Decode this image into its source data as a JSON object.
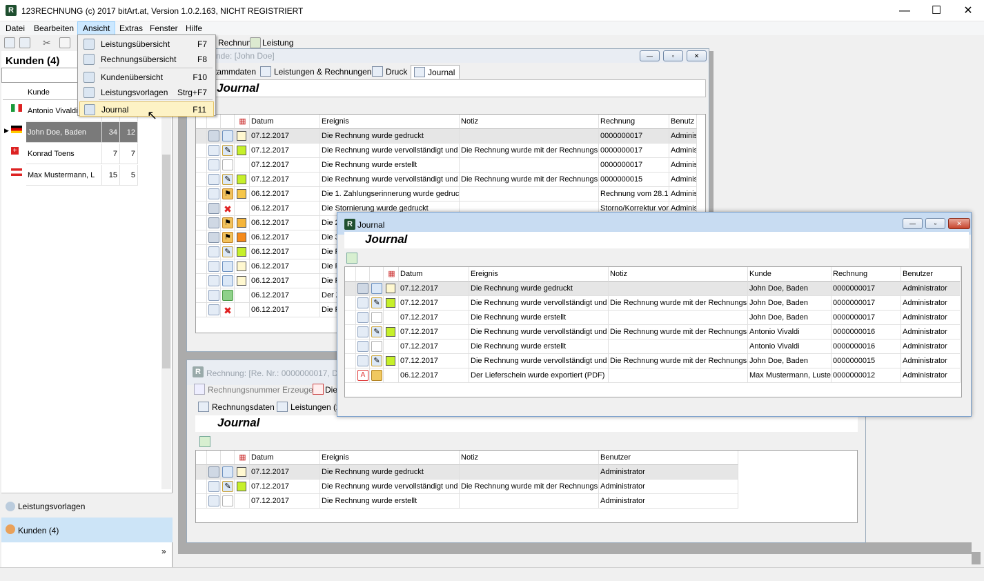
{
  "app": {
    "title": "123RECHNUNG (c) 2017 bitArt.at, Version 1.0.2.163, NICHT REGISTRIERT",
    "icon": "R"
  },
  "window_controls": {
    "minimize": "—",
    "maximize": "☐",
    "close": "✕"
  },
  "menu": [
    "Datei",
    "Bearbeiten",
    "Ansicht",
    "Extras",
    "Fenster",
    "Hilfe"
  ],
  "toolbar": {
    "rechnung_label": "Rechnung",
    "leistung_label": "Leistung"
  },
  "ansicht_menu": [
    {
      "label": "Leistungsübersicht",
      "shortcut": "F7"
    },
    {
      "label": "Rechnungsübersicht",
      "shortcut": "F8"
    },
    {
      "label": "Kundenübersicht",
      "shortcut": "F10"
    },
    {
      "label": "Leistungsvorlagen",
      "shortcut": "Strg+F7"
    },
    {
      "label": "Journal",
      "shortcut": "F11"
    }
  ],
  "left_panel": {
    "title": "Kunden (4)",
    "column_header": "Kunde",
    "customers": [
      {
        "name": "Antonio Vivaldi",
        "a": "",
        "b": "",
        "flag": "italy"
      },
      {
        "name": "John Doe, Baden",
        "a": "34",
        "b": "12",
        "flag": "germany"
      },
      {
        "name": "Konrad Toens",
        "a": "7",
        "b": "7",
        "flag": "switzerland"
      },
      {
        "name": "Max Mustermann, L",
        "a": "15",
        "b": "5",
        "flag": "austria"
      }
    ],
    "nav_leistungsvorlagen": "Leistungsvorlagen",
    "nav_kunden": "Kunden (4)",
    "more": "»"
  },
  "customer_window": {
    "title": "nde: [John Doe]",
    "tabs": [
      "tammdaten",
      "Leistungen & Rechnungen",
      "Druck",
      "Journal"
    ],
    "journal_title": "Journal",
    "headers": [
      "Datum",
      "Ereignis",
      "Notiz",
      "Rechnung",
      "Benutz"
    ],
    "rows": [
      {
        "date": "07.12.2017",
        "event": "Die Rechnung wurde gedruckt",
        "note": "",
        "invoice": "0000000017",
        "user": "Adminis",
        "status": "#fff8d0",
        "icon2": "doc"
      },
      {
        "date": "07.12.2017",
        "event": "Die Rechnung wurde vervollständigt und i",
        "note": "Die Rechnung wurde mit der Rechnungsnu",
        "invoice": "0000000017",
        "user": "Adminis",
        "status": "#c6f02a",
        "icon2": "pen"
      },
      {
        "date": "07.12.2017",
        "event": "Die Rechnung wurde erstellt",
        "note": "",
        "invoice": "0000000017",
        "user": "Adminis",
        "status": "",
        "icon2": "page"
      },
      {
        "date": "07.12.2017",
        "event": "Die Rechnung wurde vervollständigt und i",
        "note": "Die Rechnung wurde mit der Rechnungsnu",
        "invoice": "0000000015",
        "user": "Adminis",
        "status": "#c6f02a",
        "icon2": "pen"
      },
      {
        "date": "06.12.2017",
        "event": "Die 1. Zahlungserinnerung wurde gedruck",
        "note": "",
        "invoice": "Rechnung vom 28.1",
        "user": "Adminis",
        "status": "#f5c64a",
        "icon2": "flag"
      },
      {
        "date": "06.12.2017",
        "event": "Die Stornierung wurde gedruckt",
        "note": "",
        "invoice": "Storno/Korrektur vor",
        "user": "Adminis",
        "status": "",
        "icon2": "x"
      },
      {
        "date": "06.12.2017",
        "event": "Die 2",
        "note": "",
        "invoice": "",
        "user": "",
        "status": "#f5b53a",
        "icon2": "flag"
      },
      {
        "date": "06.12.2017",
        "event": "Die 3",
        "note": "",
        "invoice": "",
        "user": "",
        "status": "#f58a1a",
        "icon2": "flag"
      },
      {
        "date": "06.12.2017",
        "event": "Die R",
        "note": "",
        "invoice": "",
        "user": "",
        "status": "#c6f02a",
        "icon2": "pen"
      },
      {
        "date": "06.12.2017",
        "event": "Die R",
        "note": "",
        "invoice": "",
        "user": "",
        "status": "#fff8d0",
        "icon2": "doc"
      },
      {
        "date": "06.12.2017",
        "event": "Die R",
        "note": "",
        "invoice": "",
        "user": "",
        "status": "#fff8d0",
        "icon2": "doc"
      },
      {
        "date": "06.12.2017",
        "event": "Der Z",
        "note": "",
        "invoice": "",
        "user": "",
        "status": "",
        "icon2": "money"
      },
      {
        "date": "06.12.2017",
        "event": "Die R",
        "note": "",
        "invoice": "",
        "user": "",
        "status": "",
        "icon2": "x"
      }
    ]
  },
  "invoice_window": {
    "title": "Rechnung: [Re. Nr.: 0000000017, Dat",
    "toolbar": [
      "Rechnungsnummer Erzeugen",
      "Dies"
    ],
    "tabs": [
      "Rechnungsdaten",
      "Leistungen (2"
    ],
    "journal_title": "Journal",
    "headers": [
      "Datum",
      "Ereignis",
      "Notiz",
      "Benutzer"
    ],
    "rows": [
      {
        "date": "07.12.2017",
        "event": "Die Rechnung wurde gedruckt",
        "note": "",
        "user": "Administrator",
        "status": "#fff8d0",
        "icon2": "doc"
      },
      {
        "date": "07.12.2017",
        "event": "Die Rechnung wurde vervollständigt und i",
        "note": "Die Rechnung wurde mit der Rechnungsnu",
        "user": "Administrator",
        "status": "#c6f02a",
        "icon2": "pen"
      },
      {
        "date": "07.12.2017",
        "event": "Die Rechnung wurde erstellt",
        "note": "",
        "user": "Administrator",
        "status": "",
        "icon2": "page"
      }
    ]
  },
  "journal_window": {
    "title": "Journal",
    "journal_title": "Journal",
    "headers": [
      "Datum",
      "Ereignis",
      "Notiz",
      "Kunde",
      "Rechnung",
      "Benutzer"
    ],
    "rows": [
      {
        "date": "07.12.2017",
        "event": "Die Rechnung wurde gedruckt",
        "note": "",
        "customer": "John Doe, Baden",
        "invoice": "0000000017",
        "user": "Administrator",
        "status": "#fff8d0",
        "icon2": "doc",
        "icon1": "printer"
      },
      {
        "date": "07.12.2017",
        "event": "Die Rechnung wurde vervollständigt und i",
        "note": "Die Rechnung wurde mit der Rechnungsnu",
        "customer": "John Doe, Baden",
        "invoice": "0000000017",
        "user": "Administrator",
        "status": "#c6f02a",
        "icon2": "pen",
        "icon1": "invoice"
      },
      {
        "date": "07.12.2017",
        "event": "Die Rechnung wurde erstellt",
        "note": "",
        "customer": "John Doe, Baden",
        "invoice": "0000000017",
        "user": "Administrator",
        "status": "",
        "icon2": "page",
        "icon1": "invoice"
      },
      {
        "date": "07.12.2017",
        "event": "Die Rechnung wurde vervollständigt und i",
        "note": "Die Rechnung wurde mit der Rechnungsnu",
        "customer": "Antonio Vivaldi",
        "invoice": "0000000016",
        "user": "Administrator",
        "status": "#c6f02a",
        "icon2": "pen",
        "icon1": "invoice"
      },
      {
        "date": "07.12.2017",
        "event": "Die Rechnung wurde erstellt",
        "note": "",
        "customer": "Antonio Vivaldi",
        "invoice": "0000000016",
        "user": "Administrator",
        "status": "",
        "icon2": "page",
        "icon1": "invoice"
      },
      {
        "date": "07.12.2017",
        "event": "Die Rechnung wurde vervollständigt und i",
        "note": "Die Rechnung wurde mit der Rechnungsnu",
        "customer": "John Doe, Baden",
        "invoice": "0000000015",
        "user": "Administrator",
        "status": "#c6f02a",
        "icon2": "pen",
        "icon1": "invoice"
      },
      {
        "date": "06.12.2017",
        "event": "Der Lieferschein wurde exportiert (PDF)",
        "note": "",
        "customer": "Max Mustermann, Luster",
        "invoice": "0000000012",
        "user": "Administrator",
        "status": "",
        "icon2": "box",
        "icon1": "pdf"
      }
    ]
  }
}
